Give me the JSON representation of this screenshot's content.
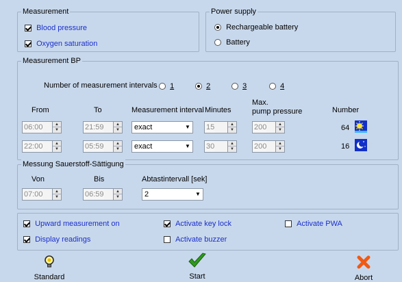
{
  "measurement": {
    "title": "Measurement",
    "blood_pressure": {
      "label": "Blood pressure",
      "checked": true
    },
    "oxygen_saturation": {
      "label": "Oxygen saturation",
      "checked": true
    }
  },
  "power_supply": {
    "title": "Power supply",
    "rechargeable": {
      "label": "Rechargeable battery",
      "selected": true
    },
    "battery": {
      "label": "Battery",
      "selected": false
    }
  },
  "measurement_bp": {
    "title": "Measurement BP",
    "intervals_label": "Number of measurement intervals",
    "interval_options": [
      "1",
      "2",
      "3",
      "4"
    ],
    "selected_interval": "2",
    "headers": {
      "from": "From",
      "to": "To",
      "measurement_interval": "Measurement interval",
      "minutes": "Minutes",
      "max_pressure_line1": "Max.",
      "max_pressure_line2": "pump pressure",
      "number": "Number"
    },
    "rows": [
      {
        "from": "06:00",
        "to": "21:59",
        "interval": "exact",
        "minutes": "15",
        "pressure": "200",
        "number": "64",
        "icon": "sun-icon"
      },
      {
        "from": "22:00",
        "to": "05:59",
        "interval": "exact",
        "minutes": "30",
        "pressure": "200",
        "number": "16",
        "icon": "moon-icon"
      }
    ]
  },
  "spo2": {
    "title": "Messung Sauerstoff-Sättigung",
    "headers": {
      "from": "Von",
      "to": "Bis",
      "interval": "Abtastintervall [sek]"
    },
    "from": "07:00",
    "to": "06:59",
    "interval": "2"
  },
  "options": {
    "upward": {
      "label": "Upward measurement on",
      "checked": true
    },
    "display": {
      "label": "Display readings",
      "checked": true
    },
    "key_lock": {
      "label": "Activate key lock",
      "checked": true
    },
    "buzzer": {
      "label": "Activate buzzer",
      "checked": false
    },
    "pwa": {
      "label": "Activate PWA",
      "checked": false
    }
  },
  "footer": {
    "standard": "Standard",
    "start": "Start",
    "abort": "Abort"
  },
  "colors": {
    "background": "#c8d8ec",
    "link_blue": "#1a2fc9",
    "start_green": "#2e9a1e",
    "abort_orange": "#f05a14"
  }
}
